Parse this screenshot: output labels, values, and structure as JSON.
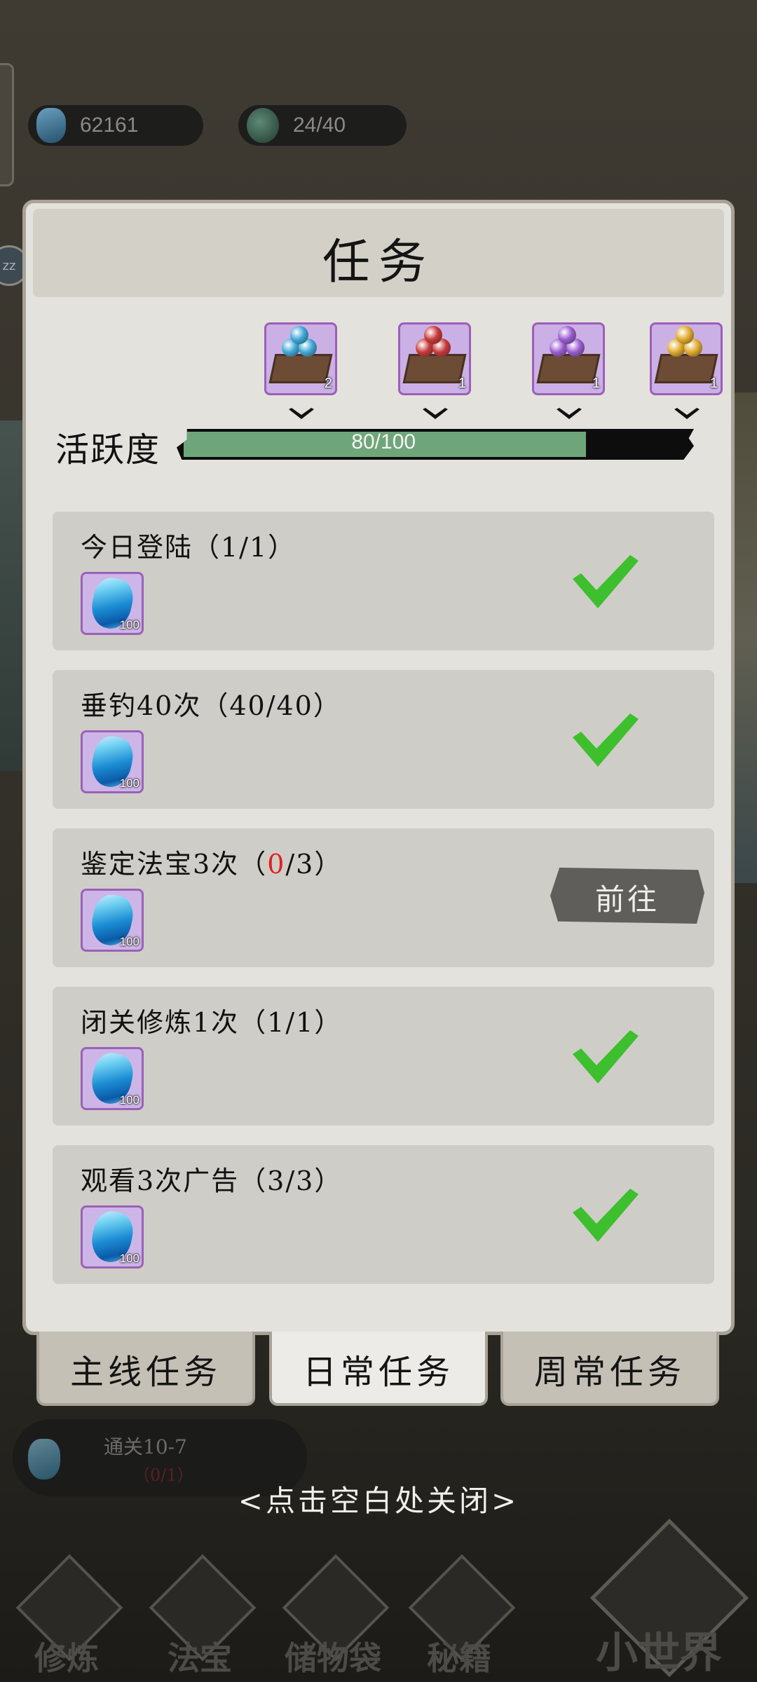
{
  "top_bar": {
    "spirit_stones": "62161",
    "stamina": "24/40"
  },
  "dialog": {
    "title": "任务",
    "activity": {
      "label": "活跃度",
      "current": 80,
      "max": 100,
      "text": "80/100",
      "progress_fraction": 0.8
    },
    "chests": [
      {
        "item": "blue-orb-tray-icon",
        "color": "#3ea8d6",
        "count": "2"
      },
      {
        "item": "red-orb-tray-icon",
        "color": "#c83838",
        "count": "1"
      },
      {
        "item": "purple-orb-tray-icon",
        "color": "#9a5cd0",
        "count": "1"
      },
      {
        "item": "gold-orb-tray-icon",
        "color": "#e0aa2a",
        "count": "1"
      }
    ],
    "tasks": [
      {
        "title": "今日登陆（1/1）",
        "reward_count": "100",
        "status": "complete"
      },
      {
        "title": "垂钓40次（40/40）",
        "reward_count": "100",
        "status": "complete"
      },
      {
        "title_prefix": "鉴定法宝3次（",
        "title_progress": "0",
        "title_suffix": "/3）",
        "reward_count": "100",
        "status": "incomplete",
        "button": "前往"
      },
      {
        "title": "闭关修炼1次（1/1）",
        "reward_count": "100",
        "status": "complete"
      },
      {
        "title": "观看3次广告（3/3）",
        "reward_count": "100",
        "status": "complete"
      }
    ]
  },
  "tabs": [
    {
      "label": "主线任务",
      "active": false
    },
    {
      "label": "日常任务",
      "active": true
    },
    {
      "label": "周常任务",
      "active": false
    }
  ],
  "background": {
    "quest_text": "通关10-7",
    "quest_progress": "（0/1）",
    "close_hint": "<点击空白处关闭>",
    "nav": [
      "修炼",
      "法宝",
      "储物袋",
      "秘籍",
      "小世界"
    ],
    "sleep_badge": "zz"
  },
  "colors": {
    "progress_fill": "#6fa57a",
    "check": "#3dbf2e",
    "accent_red": "#e02020"
  }
}
